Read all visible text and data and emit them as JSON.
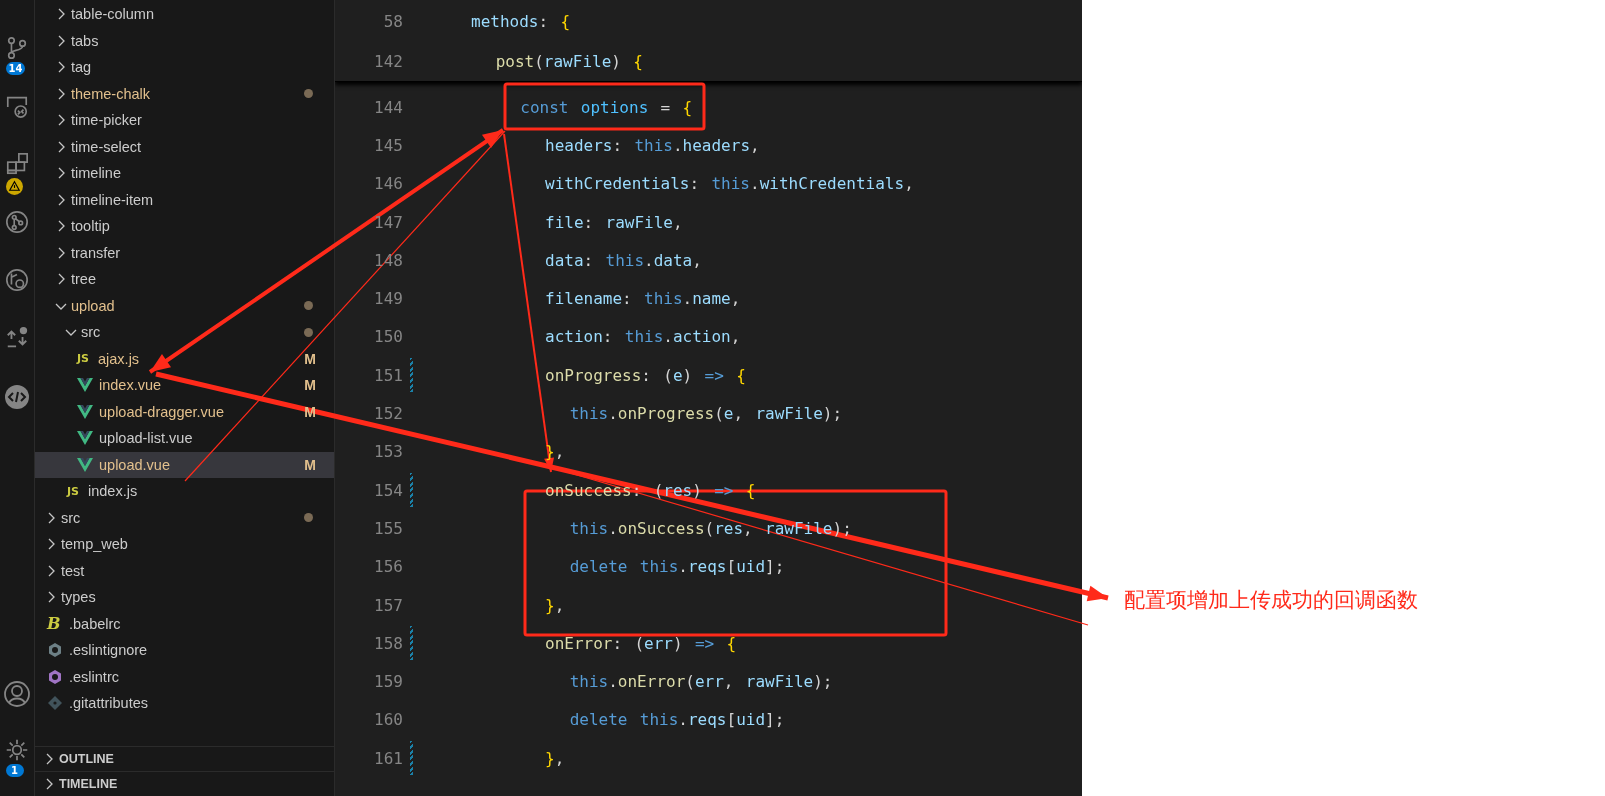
{
  "activity_bar": {
    "top": [
      {
        "kind": "source-control",
        "badge": "14",
        "warning": false
      },
      {
        "kind": "remote",
        "warning": false
      },
      {
        "kind": "extensions",
        "warning": true
      },
      {
        "kind": "git-graph",
        "warning": false
      },
      {
        "kind": "history",
        "warning": false
      },
      {
        "kind": "diff",
        "warning": false
      },
      {
        "kind": "api",
        "warning": false
      }
    ],
    "bottom": [
      {
        "kind": "account",
        "warning": false
      },
      {
        "kind": "settings",
        "badge": "1",
        "warning": false
      }
    ]
  },
  "explorer": {
    "tree": [
      {
        "children": [
          {
            "label": "table-column",
            "kind": "folder",
            "expanded": false,
            "modified": false,
            "dot": false,
            "selected": false
          },
          {
            "label": "tabs",
            "kind": "folder",
            "expanded": false,
            "modified": false,
            "dot": false,
            "selected": false
          },
          {
            "label": "tag",
            "kind": "folder",
            "expanded": false,
            "modified": false,
            "dot": false,
            "selected": false
          },
          {
            "label": "theme-chalk",
            "kind": "folder",
            "expanded": false,
            "modified": true,
            "dot": true,
            "selected": false
          },
          {
            "label": "time-picker",
            "kind": "folder",
            "expanded": false,
            "modified": false,
            "dot": false,
            "selected": false
          },
          {
            "label": "time-select",
            "kind": "folder",
            "expanded": false,
            "modified": false,
            "dot": false,
            "selected": false
          },
          {
            "label": "timeline",
            "kind": "folder",
            "expanded": false,
            "modified": false,
            "dot": false,
            "selected": false
          },
          {
            "label": "timeline-item",
            "kind": "folder",
            "expanded": false,
            "modified": false,
            "dot": false,
            "selected": false
          },
          {
            "label": "tooltip",
            "kind": "folder",
            "expanded": false,
            "modified": false,
            "dot": false,
            "selected": false
          },
          {
            "label": "transfer",
            "kind": "folder",
            "expanded": false,
            "modified": false,
            "dot": false,
            "selected": false
          },
          {
            "label": "tree",
            "kind": "folder",
            "expanded": false,
            "modified": false,
            "dot": false,
            "selected": false
          },
          {
            "label": "upload",
            "kind": "folder",
            "expanded": true,
            "modified": true,
            "dot": true,
            "selected": false,
            "children": [
              {
                "label": "src",
                "kind": "folder",
                "expanded": true,
                "modified": false,
                "dot": true,
                "selected": false,
                "children": [
                  {
                    "label": "ajax.js",
                    "kind": "js",
                    "icon_text": "JS",
                    "modified": true,
                    "badge": "M",
                    "dot": false,
                    "selected": false
                  },
                  {
                    "label": "index.vue",
                    "kind": "vue",
                    "modified": true,
                    "badge": "M",
                    "dot": false,
                    "selected": false
                  },
                  {
                    "label": "upload-dragger.vue",
                    "kind": "vue",
                    "modified": true,
                    "badge": "M",
                    "dot": false,
                    "selected": false
                  },
                  {
                    "label": "upload-list.vue",
                    "kind": "vue",
                    "modified": false,
                    "dot": false,
                    "selected": false
                  },
                  {
                    "label": "upload.vue",
                    "kind": "vue",
                    "modified": true,
                    "badge": "M",
                    "dot": false,
                    "selected": true
                  }
                ]
              },
              {
                "label": "index.js",
                "kind": "js",
                "icon_text": "JS",
                "modified": false,
                "dot": false,
                "selected": false
              }
            ]
          }
        ]
      },
      {
        "label": "src",
        "kind": "folder",
        "expanded": false,
        "modified": false,
        "dot": true,
        "selected": false
      },
      {
        "label": "temp_web",
        "kind": "folder",
        "expanded": false,
        "modified": false,
        "dot": false,
        "selected": false
      },
      {
        "label": "test",
        "kind": "folder",
        "expanded": false,
        "modified": false,
        "dot": false,
        "selected": false
      },
      {
        "label": "types",
        "kind": "folder",
        "expanded": false,
        "modified": false,
        "dot": false,
        "selected": false
      },
      {
        "label": ".babelrc",
        "kind": "babel",
        "icon_text": "B",
        "modified": false,
        "dot": false,
        "selected": false
      },
      {
        "label": ".eslintignore",
        "kind": "eslintignore",
        "modified": false,
        "dot": false,
        "selected": false
      },
      {
        "label": ".eslintrc",
        "kind": "eslintrc",
        "modified": false,
        "dot": false,
        "selected": false
      },
      {
        "label": ".gitattributes",
        "kind": "git",
        "modified": false,
        "dot": false,
        "selected": false
      }
    ],
    "sections": [
      {
        "label": "OUTLINE",
        "expanded": false
      },
      {
        "label": "TIMELINE",
        "expanded": false
      }
    ]
  },
  "editor": {
    "sticky_lines": [
      {
        "number": "58",
        "tokens": [
          {
            "text": "methods",
            "kind": "key"
          },
          {
            "text": ": ",
            "kind": "punct"
          },
          {
            "text": "{",
            "kind": "brace"
          }
        ]
      },
      {
        "number": "142",
        "tokens": [
          {
            "text": "  post",
            "kind": "function"
          },
          {
            "text": "(",
            "kind": "punct"
          },
          {
            "text": "rawFile",
            "kind": "key"
          },
          {
            "text": ") ",
            "kind": "punct"
          },
          {
            "text": "{",
            "kind": "brace"
          }
        ]
      }
    ],
    "lines": [
      {
        "number": "144",
        "changed": false,
        "tokens": [
          {
            "text": "    const ",
            "kind": "keyword"
          },
          {
            "text": "options",
            "kind": "constant"
          },
          {
            "text": " = ",
            "kind": "punct"
          },
          {
            "text": "{",
            "kind": "brace"
          }
        ]
      },
      {
        "number": "145",
        "changed": false,
        "tokens": [
          {
            "text": "      headers",
            "kind": "key"
          },
          {
            "text": ": ",
            "kind": "punct"
          },
          {
            "text": "this",
            "kind": "keyword"
          },
          {
            "text": ".",
            "kind": "punct"
          },
          {
            "text": "headers",
            "kind": "key"
          },
          {
            "text": ",",
            "kind": "punct"
          }
        ]
      },
      {
        "number": "146",
        "changed": false,
        "tokens": [
          {
            "text": "      withCredentials",
            "kind": "key"
          },
          {
            "text": ": ",
            "kind": "punct"
          },
          {
            "text": "this",
            "kind": "keyword"
          },
          {
            "text": ".",
            "kind": "punct"
          },
          {
            "text": "withCredentials",
            "kind": "key"
          },
          {
            "text": ",",
            "kind": "punct"
          }
        ]
      },
      {
        "number": "147",
        "changed": false,
        "tokens": [
          {
            "text": "      file",
            "kind": "key"
          },
          {
            "text": ": ",
            "kind": "punct"
          },
          {
            "text": "rawFile",
            "kind": "key"
          },
          {
            "text": ",",
            "kind": "punct"
          }
        ]
      },
      {
        "number": "148",
        "changed": false,
        "tokens": [
          {
            "text": "      data",
            "kind": "key"
          },
          {
            "text": ": ",
            "kind": "punct"
          },
          {
            "text": "this",
            "kind": "keyword"
          },
          {
            "text": ".",
            "kind": "punct"
          },
          {
            "text": "data",
            "kind": "key"
          },
          {
            "text": ",",
            "kind": "punct"
          }
        ]
      },
      {
        "number": "149",
        "changed": false,
        "tokens": [
          {
            "text": "      filename",
            "kind": "key"
          },
          {
            "text": ": ",
            "kind": "punct"
          },
          {
            "text": "this",
            "kind": "keyword"
          },
          {
            "text": ".",
            "kind": "punct"
          },
          {
            "text": "name",
            "kind": "key"
          },
          {
            "text": ",",
            "kind": "punct"
          }
        ]
      },
      {
        "number": "150",
        "changed": false,
        "tokens": [
          {
            "text": "      action",
            "kind": "key"
          },
          {
            "text": ": ",
            "kind": "punct"
          },
          {
            "text": "this",
            "kind": "keyword"
          },
          {
            "text": ".",
            "kind": "punct"
          },
          {
            "text": "action",
            "kind": "key"
          },
          {
            "text": ",",
            "kind": "punct"
          }
        ]
      },
      {
        "number": "151",
        "changed": true,
        "tokens": [
          {
            "text": "      onProgress",
            "kind": "function"
          },
          {
            "text": ": (",
            "kind": "punct"
          },
          {
            "text": "e",
            "kind": "key"
          },
          {
            "text": ") ",
            "kind": "punct"
          },
          {
            "text": "=> ",
            "kind": "keyword"
          },
          {
            "text": "{",
            "kind": "brace"
          }
        ]
      },
      {
        "number": "152",
        "changed": false,
        "tokens": [
          {
            "text": "        this",
            "kind": "keyword"
          },
          {
            "text": ".",
            "kind": "punct"
          },
          {
            "text": "onProgress",
            "kind": "function"
          },
          {
            "text": "(",
            "kind": "punct"
          },
          {
            "text": "e",
            "kind": "key"
          },
          {
            "text": ", ",
            "kind": "punct"
          },
          {
            "text": "rawFile",
            "kind": "key"
          },
          {
            "text": ");",
            "kind": "punct"
          }
        ]
      },
      {
        "number": "153",
        "changed": false,
        "tokens": [
          {
            "text": "      }",
            "kind": "brace"
          },
          {
            "text": ",",
            "kind": "punct"
          }
        ]
      },
      {
        "number": "154",
        "changed": true,
        "tokens": [
          {
            "text": "      onSuccess",
            "kind": "function"
          },
          {
            "text": ": (",
            "kind": "punct"
          },
          {
            "text": "res",
            "kind": "key"
          },
          {
            "text": ") ",
            "kind": "punct"
          },
          {
            "text": "=> ",
            "kind": "keyword"
          },
          {
            "text": "{",
            "kind": "brace"
          }
        ]
      },
      {
        "number": "155",
        "changed": false,
        "tokens": [
          {
            "text": "        this",
            "kind": "keyword"
          },
          {
            "text": ".",
            "kind": "punct"
          },
          {
            "text": "onSuccess",
            "kind": "function"
          },
          {
            "text": "(",
            "kind": "punct"
          },
          {
            "text": "res",
            "kind": "key"
          },
          {
            "text": ", ",
            "kind": "punct"
          },
          {
            "text": "rawFile",
            "kind": "key"
          },
          {
            "text": ");",
            "kind": "punct"
          }
        ]
      },
      {
        "number": "156",
        "changed": false,
        "tokens": [
          {
            "text": "        delete this",
            "kind": "keyword"
          },
          {
            "text": ".",
            "kind": "punct"
          },
          {
            "text": "reqs",
            "kind": "key"
          },
          {
            "text": "[",
            "kind": "punct"
          },
          {
            "text": "uid",
            "kind": "key"
          },
          {
            "text": "];",
            "kind": "punct"
          }
        ]
      },
      {
        "number": "157",
        "changed": false,
        "tokens": [
          {
            "text": "      }",
            "kind": "brace"
          },
          {
            "text": ",",
            "kind": "punct"
          }
        ]
      },
      {
        "number": "158",
        "changed": true,
        "tokens": [
          {
            "text": "      onError",
            "kind": "function"
          },
          {
            "text": ": (",
            "kind": "punct"
          },
          {
            "text": "err",
            "kind": "key"
          },
          {
            "text": ") ",
            "kind": "punct"
          },
          {
            "text": "=> ",
            "kind": "keyword"
          },
          {
            "text": "{",
            "kind": "brace"
          }
        ]
      },
      {
        "number": "159",
        "changed": false,
        "tokens": [
          {
            "text": "        this",
            "kind": "keyword"
          },
          {
            "text": ".",
            "kind": "punct"
          },
          {
            "text": "onError",
            "kind": "function"
          },
          {
            "text": "(",
            "kind": "punct"
          },
          {
            "text": "err",
            "kind": "key"
          },
          {
            "text": ", ",
            "kind": "punct"
          },
          {
            "text": "rawFile",
            "kind": "key"
          },
          {
            "text": ");",
            "kind": "punct"
          }
        ]
      },
      {
        "number": "160",
        "changed": false,
        "tokens": [
          {
            "text": "        delete this",
            "kind": "keyword"
          },
          {
            "text": ".",
            "kind": "punct"
          },
          {
            "text": "reqs",
            "kind": "key"
          },
          {
            "text": "[",
            "kind": "punct"
          },
          {
            "text": "uid",
            "kind": "key"
          },
          {
            "text": "];",
            "kind": "punct"
          }
        ]
      },
      {
        "number": "161",
        "changed": true,
        "tokens": [
          {
            "text": "      }",
            "kind": "brace"
          },
          {
            "text": ",",
            "kind": "punct"
          }
        ]
      }
    ]
  },
  "annotation": {
    "note": "配置项增加上传成功的回调函数"
  }
}
